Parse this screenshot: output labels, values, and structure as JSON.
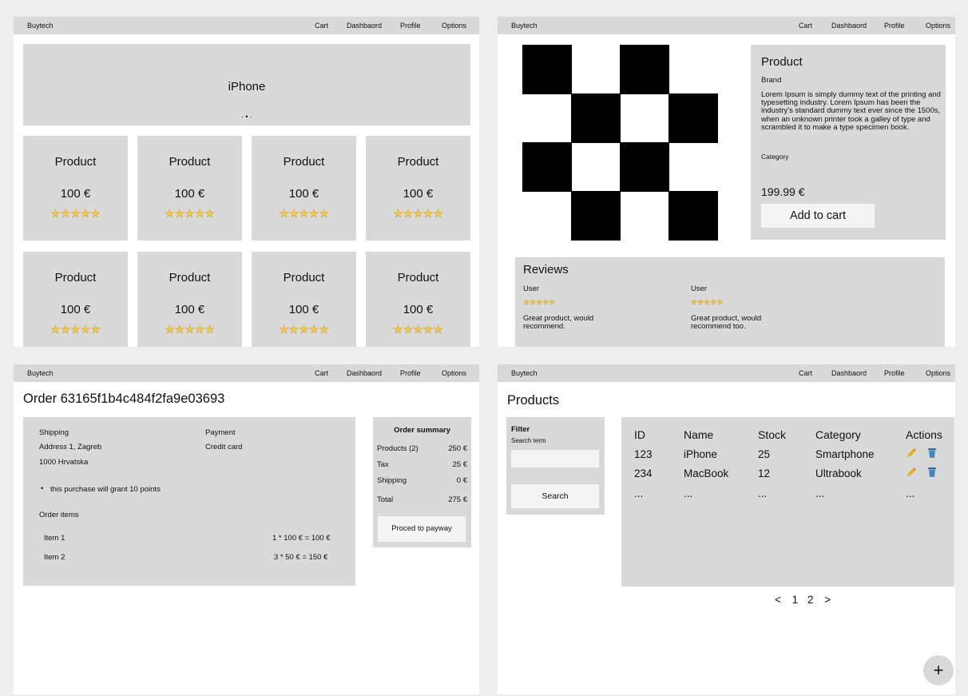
{
  "navbar": {
    "brand": "Buytech",
    "links": [
      "Cart",
      "Dashbaord",
      "Profile",
      "Options"
    ]
  },
  "home": {
    "banner_title": "iPhone",
    "carousel_dots": "· • ·",
    "products": [
      {
        "name": "Product",
        "price": "100 €",
        "stars": "★★★★★"
      },
      {
        "name": "Product",
        "price": "100 €",
        "stars": "★★★★★"
      },
      {
        "name": "Product",
        "price": "100 €",
        "stars": "★★★★★"
      },
      {
        "name": "Product",
        "price": "100 €",
        "stars": "★★★★★"
      },
      {
        "name": "Product",
        "price": "100 €",
        "stars": "★★★★★"
      },
      {
        "name": "Product",
        "price": "100 €",
        "stars": "★★★★★"
      },
      {
        "name": "Product",
        "price": "100 €",
        "stars": "★★★★★"
      },
      {
        "name": "Product",
        "price": "100 €",
        "stars": "★★★★★"
      }
    ]
  },
  "detail": {
    "title": "Product",
    "brand": "Brand",
    "description": "Lorem Ipsum is simply dummy text of the printing and typesetting industry. Lorem Ipsum has been the industry's standard dummy text ever since the 1500s, when an unknown printer took a galley of type and scrambled it to make a type specimen book.",
    "category": "Category",
    "price": "199.99 €",
    "add_to_cart": "Add to cart",
    "reviews_title": "Reviews",
    "reviews": [
      {
        "user": "User",
        "stars": "★★★★★",
        "text": "Great product, would recommend."
      },
      {
        "user": "User",
        "stars": "★★★★★",
        "text": "Great product, would recommend too."
      }
    ]
  },
  "order": {
    "title": "Order 63165f1b4c484f2fa9e03693",
    "shipping_label": "Shipping",
    "address1": "Address 1, Zagreb",
    "address2": "1000 Hrvatska",
    "payment_label": "Payment",
    "payment_method": "Credit card",
    "points_note": "this purchase will grant 10 points",
    "items_label": "Order items",
    "items": [
      {
        "name": "Item 1",
        "calc": "1 * 100 € = 100 €"
      },
      {
        "name": "Item 2",
        "calc": "3 * 50 € = 150 €"
      }
    ],
    "summary": {
      "title": "Order summary",
      "rows": [
        {
          "label": "Products (2)",
          "value": "250 €"
        },
        {
          "label": "Tax",
          "value": "25 €"
        },
        {
          "label": "Shipping",
          "value": "0 €"
        },
        {
          "label": "Total",
          "value": "275 €"
        }
      ],
      "button": "Proced to payway"
    }
  },
  "admin": {
    "title": "Products",
    "filter_title": "Filter",
    "search_term_label": "Search term",
    "search_button": "Search",
    "columns": [
      "ID",
      "Name",
      "Stock",
      "Category",
      "Actions"
    ],
    "rows": [
      {
        "id": "123",
        "name": "iPhone",
        "stock": "25",
        "category": "Smartphone"
      },
      {
        "id": "234",
        "name": "MacBook",
        "stock": "12",
        "category": "Ultrabook"
      },
      {
        "id": "...",
        "name": "...",
        "stock": "...",
        "category": "...",
        "actions": "..."
      }
    ],
    "pagination": {
      "prev": "<",
      "pages": [
        "1",
        "2"
      ],
      "next": ">"
    },
    "fab": "+"
  }
}
